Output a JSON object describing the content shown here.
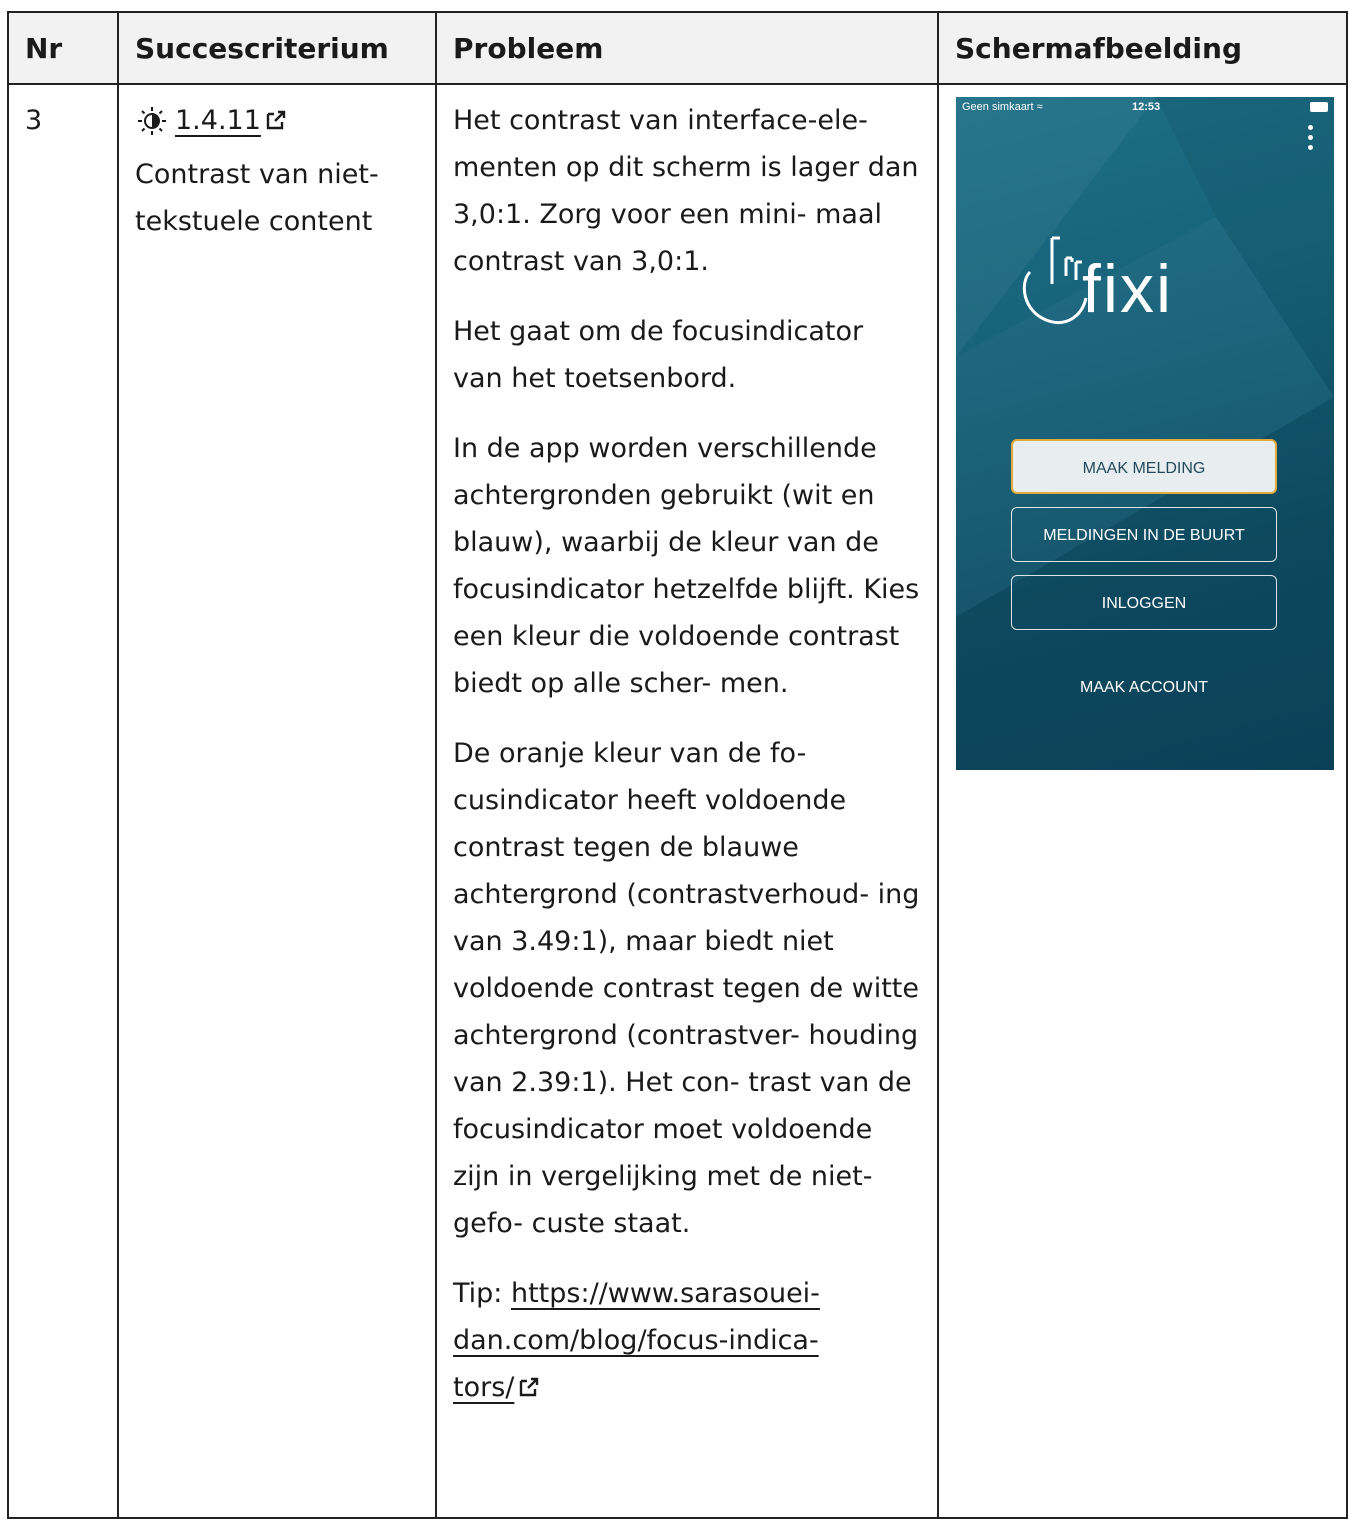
{
  "table": {
    "headers": {
      "nr": "Nr",
      "criterion": "Succescriterium",
      "problem": "Probleem",
      "screenshot": "Schermafbeelding"
    },
    "row": {
      "nr": "3",
      "criterion_icon": "contrast-icon",
      "criterion_link": "1.4.11",
      "criterion_link_icon": "external-link-icon",
      "criterion_name_line1": "Contrast van niet-",
      "criterion_name_line2": "tekstuele content",
      "problem_paragraphs": [
        "Het contrast van interface-ele- menten op dit scherm is lager dan 3,0:1. Zorg voor een mini- maal contrast van 3,0:1.",
        "Het gaat om de focusindicator van het toetsenbord.",
        "In de app worden verschillende achtergronden gebruikt (wit en blauw), waarbij de kleur van de focusindicator hetzelfde blijft. Kies een kleur die voldoende contrast biedt op alle scher- men.",
        "De oranje kleur van de fo- cusindicator heeft voldoende contrast tegen de blauwe achtergrond (contrastverhoud- ing van 3.49:1), maar biedt niet voldoende contrast tegen de witte achtergrond (contrastver- houding van 2.39:1). Het con- trast van de focusindicator moet voldoende zijn in vergelijking met de niet-gefo- custe staat."
      ],
      "tip_label": "Tip: ",
      "tip_link": "https://www.sarasoueidan.com/blog/focus-indicators/",
      "tip_link_display_line1": "https://www.sarasouei-",
      "tip_link_display_line2": "dan.com/blog/focus-indica-",
      "tip_link_display_line3": "tors/"
    }
  },
  "phone": {
    "carrier": "Geen simkaart",
    "time": "12:53",
    "logo_text": "fixi",
    "buttons": [
      "MAAK MELDING",
      "MELDINGEN IN DE BUURT",
      "INLOGGEN"
    ],
    "link": "MAAK ACCOUNT",
    "colors": {
      "background": "#16627a",
      "focus_ring": "#e4a93b",
      "focused_button_bg": "#e8eef0"
    }
  }
}
